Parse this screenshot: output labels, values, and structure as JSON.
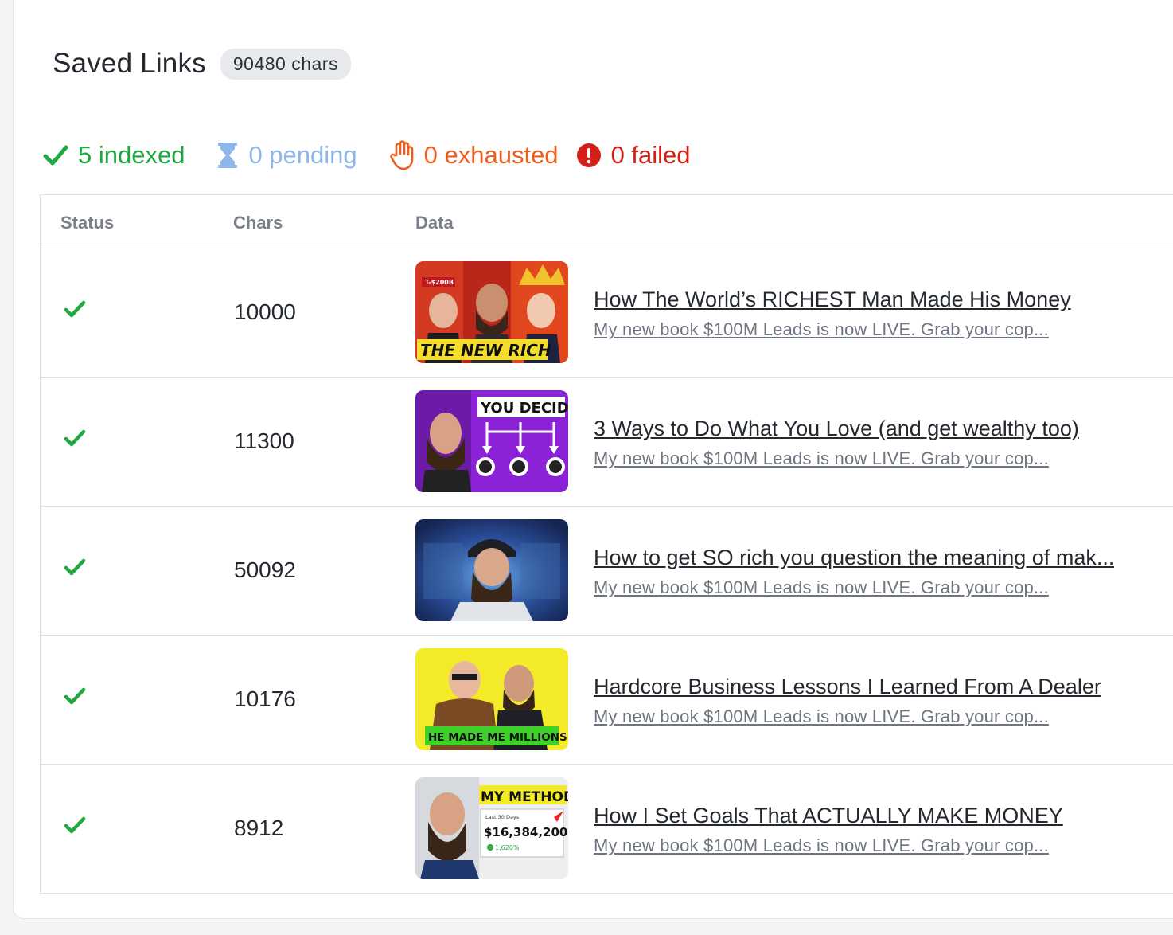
{
  "header": {
    "title": "Saved Links",
    "badge": "90480 chars"
  },
  "stats": {
    "indexed": "5 indexed",
    "pending": "0 pending",
    "exhausted": "0 exhausted",
    "failed": "0 failed"
  },
  "colors": {
    "indexed": "#1fa83f",
    "pending": "#8db7ea",
    "exhausted": "#ef5d1c",
    "failed": "#d32016"
  },
  "table": {
    "headers": {
      "status": "Status",
      "chars": "Chars",
      "data": "Data"
    },
    "rows": [
      {
        "status_icon": "check-icon",
        "chars": "10000",
        "title": "How The World’s RICHEST Man Made His Money",
        "desc": "My new book $100M Leads is now LIVE. Grab your cop...",
        "thumb_caption": "THE NEW RICH",
        "thumb_tag": "T-$200B"
      },
      {
        "status_icon": "check-icon",
        "chars": "11300",
        "title": "3 Ways to Do What You Love (and get wealthy too)",
        "desc": "My new book $100M Leads is now LIVE. Grab your cop...",
        "thumb_caption": "YOU DECIDE"
      },
      {
        "status_icon": "check-icon",
        "chars": "50092",
        "title": "How to get SO rich you question the meaning of mak...",
        "desc": "My new book $100M Leads is now LIVE. Grab your cop...",
        "thumb_caption": ""
      },
      {
        "status_icon": "check-icon",
        "chars": "10176",
        "title": "Hardcore Business Lessons I Learned From A Dealer",
        "desc": "My new book $100M Leads is now LIVE. Grab your cop...",
        "thumb_caption": "HE MADE ME MILLIONS"
      },
      {
        "status_icon": "check-icon",
        "chars": "8912",
        "title": "How I Set Goals That ACTUALLY MAKE MONEY",
        "desc": "My new book $100M Leads is now LIVE. Grab your cop...",
        "thumb_caption": "MY METHOD",
        "thumb_small": "Last 30 Days",
        "thumb_amount": "$16,384,200",
        "thumb_pct": "1,620%"
      }
    ]
  }
}
